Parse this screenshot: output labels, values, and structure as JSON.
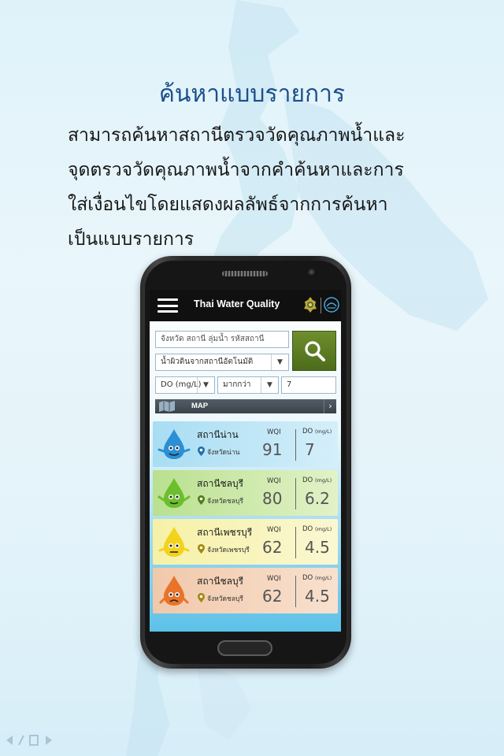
{
  "headline": "ค้นหาแบบรายการ",
  "description_lines": [
    "สามารถค้นหาสถานีตรวจวัดคุณภาพน้ำและ",
    "จุดตรวจวัดคุณภาพน้ำจากคำค้นหาและการ",
    "ใส่เงื่อนไขโดยแสดงผลลัพธ์จากการค้นหา",
    "เป็นแบบรายการ"
  ],
  "app": {
    "title": "Thai Water Quality",
    "search_placeholder": "จังหวัด  สถานี  ลุ่มน้ำ  รหัสสถานี",
    "source_select": "น้ำผิวดินจากสถานีอัตโนมัติ",
    "param_select": "DO (mg/L)",
    "operator_select": "มากกว่า",
    "threshold_value": "7",
    "map_label": "MAP"
  },
  "stations": [
    {
      "name": "สถานีน่าน",
      "province": "จังหวัดน่าน",
      "wqi_label": "WQI",
      "wqi": "91",
      "do_label": "DO",
      "do_unit": "(mg/L)",
      "do": "7",
      "color": "#2a8fd4"
    },
    {
      "name": "สถานีชลบุรี",
      "province": "จังหวัดชลบุรี",
      "wqi_label": "WQI",
      "wqi": "80",
      "do_label": "DO",
      "do_unit": "(mg/L)",
      "do": "6.2",
      "color": "#6cbf2c"
    },
    {
      "name": "สถานีเพชรบุรี",
      "province": "จังหวัดเพชรบุรี",
      "wqi_label": "WQI",
      "wqi": "62",
      "do_label": "DO",
      "do_unit": "(mg/L)",
      "do": "4.5",
      "color": "#f2d21c"
    },
    {
      "name": "สถานีชลบุรี",
      "province": "จังหวัดชลบุรี",
      "wqi_label": "WQI",
      "wqi": "62",
      "do_label": "DO",
      "do_unit": "(mg/L)",
      "do": "4.5",
      "color": "#e8742a"
    }
  ]
}
